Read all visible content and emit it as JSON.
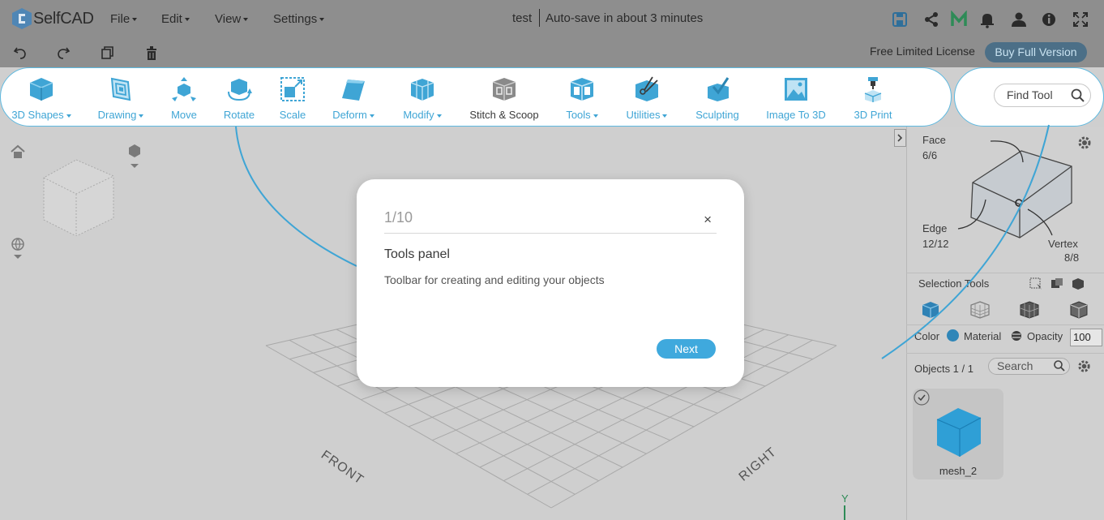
{
  "app": {
    "name": "SelfCAD"
  },
  "menu": [
    {
      "label": "File"
    },
    {
      "label": "Edit"
    },
    {
      "label": "View"
    },
    {
      "label": "Settings"
    }
  ],
  "document": {
    "title": "test",
    "autosave": "Auto-save in about 3 minutes"
  },
  "license": {
    "text": "Free Limited License",
    "buy_label": "Buy Full Version"
  },
  "tools": [
    {
      "label": "3D Shapes",
      "icon": "cube-icon",
      "dropdown": true
    },
    {
      "label": "Drawing",
      "icon": "drawing-icon",
      "dropdown": true
    },
    {
      "label": "Move",
      "icon": "move-icon",
      "dropdown": false
    },
    {
      "label": "Rotate",
      "icon": "rotate-icon",
      "dropdown": false
    },
    {
      "label": "Scale",
      "icon": "scale-icon",
      "dropdown": false
    },
    {
      "label": "Deform",
      "icon": "deform-icon",
      "dropdown": true
    },
    {
      "label": "Modify",
      "icon": "modify-icon",
      "dropdown": true
    },
    {
      "label": "Stitch & Scoop",
      "icon": "stitch-scoop-icon",
      "dropdown": false
    },
    {
      "label": "Tools",
      "icon": "tools-icon",
      "dropdown": true
    },
    {
      "label": "Utilities",
      "icon": "utilities-icon",
      "dropdown": true
    },
    {
      "label": "Sculpting",
      "icon": "sculpting-icon",
      "dropdown": false
    },
    {
      "label": "Image To 3D",
      "icon": "image-to-3d-icon",
      "dropdown": false
    },
    {
      "label": "3D Print",
      "icon": "3d-print-icon",
      "dropdown": false
    }
  ],
  "find_tool": {
    "placeholder": "Find Tool"
  },
  "viewport": {
    "front_label": "FRONT",
    "right_label": "RIGHT",
    "axis_y": "Y"
  },
  "selection": {
    "face": "Face",
    "face_count": "6/6",
    "edge": "Edge",
    "edge_count": "12/12",
    "vertex": "Vertex",
    "vertex_count": "8/8",
    "tools_label": "Selection Tools"
  },
  "material_row": {
    "color": "Color",
    "material": "Material",
    "opacity": "Opacity",
    "opacity_value": "100"
  },
  "objects": {
    "label": "Objects 1 / 1",
    "search_placeholder": "Search",
    "items": [
      {
        "name": "mesh_2"
      }
    ]
  },
  "tour": {
    "step": "1/10",
    "close": "×",
    "title": "Tools panel",
    "description": "Toolbar for creating and editing your objects",
    "next_label": "Next"
  },
  "colors": {
    "accent": "#3fa5d5",
    "topbar": "#8e8e8e",
    "viewport": "#cfcfcf",
    "buy_button": "#4c6f87"
  }
}
